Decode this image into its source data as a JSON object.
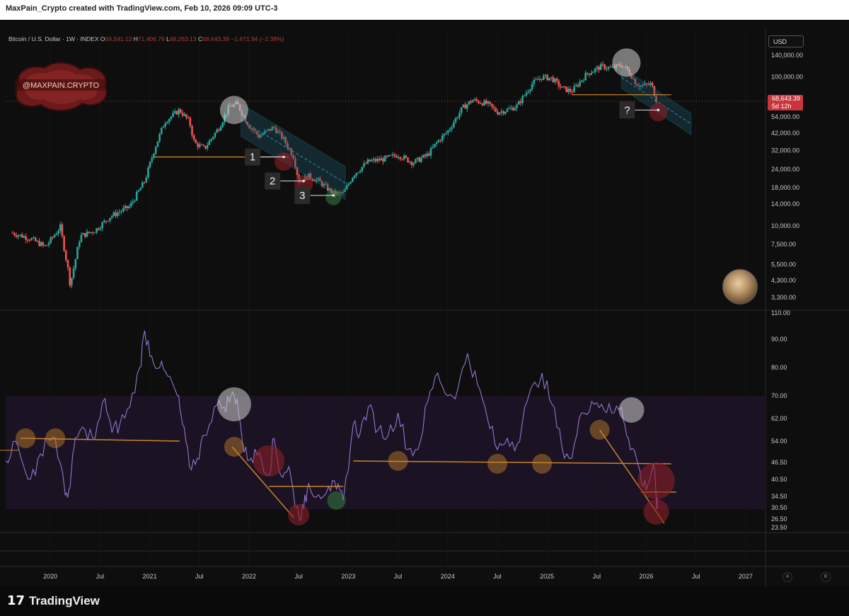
{
  "header": {
    "attribution": "MaxPain_Crypto created with TradingView.com, Feb 10, 2026 09:09 UTC-3"
  },
  "legend": {
    "symbol": "Bitcoin / U.S. Dollar · 1W · INDEX",
    "open_label": "O",
    "open": "69,541.13",
    "high_label": "H",
    "high": "71,406.76",
    "low_label": "L",
    "low": "68,263.13",
    "close_label": "C",
    "close": "68,643.39",
    "change": "−1,671.94 (−2.38%)"
  },
  "currency": "USD",
  "price_tag": {
    "price": "68,643.39",
    "countdown": "5d 12h"
  },
  "watermark": {
    "text": "@MAXPAIN.CRYPTO"
  },
  "footer": {
    "brand": "TradingView",
    "brand_mark": "17"
  },
  "axis_buttons": [
    "A",
    "B"
  ],
  "colors": {
    "up": "#26a69a",
    "down": "#ef5350",
    "rsi": "#9575cd",
    "trend": "#c8832a",
    "channel": "#1e5c6e",
    "grey_marker": "#c8c8c8",
    "red_marker": "#8a1f26",
    "green_marker": "#2a5a2f",
    "price_tag": "#c8353c"
  },
  "chart_data": [
    {
      "type": "candlestick",
      "name": "Bitcoin / U.S. Dollar",
      "scale": "log",
      "price_ticks": [
        "140,000.00",
        "100,000.00",
        "54,000.00",
        "42,000.00",
        "32,000.00",
        "24,000.00",
        "18,000.00",
        "14,000.00",
        "10,000.00",
        "7,500.00",
        "5,500.00",
        "4,300.00",
        "3,300.00"
      ],
      "price_tick_values": [
        140000,
        100000,
        54000,
        42000,
        32000,
        24000,
        18000,
        14000,
        10000,
        7500,
        5500,
        4300,
        3300
      ],
      "x_ticks": [
        "2020",
        "Jul",
        "2021",
        "Jul",
        "2022",
        "Jul",
        "2023",
        "Jul",
        "2024",
        "Jul",
        "2025",
        "Jul",
        "2026",
        "Jul",
        "2027"
      ],
      "x_tick_dates": [
        2020.0,
        2020.5,
        2021.0,
        2021.5,
        2022.0,
        2022.5,
        2023.0,
        2023.5,
        2024.0,
        2024.5,
        2025.0,
        2025.5,
        2026.0,
        2026.5,
        2027.0
      ],
      "price_path": [
        [
          2019.6,
          9000
        ],
        [
          2019.8,
          8200
        ],
        [
          2019.95,
          7200
        ],
        [
          2020.1,
          9800
        ],
        [
          2020.18,
          5000
        ],
        [
          2020.2,
          4000
        ],
        [
          2020.3,
          8500
        ],
        [
          2020.45,
          9300
        ],
        [
          2020.6,
          11500
        ],
        [
          2020.8,
          13500
        ],
        [
          2020.95,
          20000
        ],
        [
          2021.05,
          33000
        ],
        [
          2021.15,
          50000
        ],
        [
          2021.3,
          60000
        ],
        [
          2021.4,
          50000
        ],
        [
          2021.45,
          36000
        ],
        [
          2021.55,
          33000
        ],
        [
          2021.7,
          46000
        ],
        [
          2021.8,
          63000
        ],
        [
          2021.88,
          66000
        ],
        [
          2022.0,
          47000
        ],
        [
          2022.1,
          40000
        ],
        [
          2022.25,
          46000
        ],
        [
          2022.35,
          38000
        ],
        [
          2022.45,
          29000
        ],
        [
          2022.5,
          20000
        ],
        [
          2022.6,
          21500
        ],
        [
          2022.7,
          20000
        ],
        [
          2022.85,
          16500
        ],
        [
          2022.95,
          16500
        ],
        [
          2023.05,
          22000
        ],
        [
          2023.2,
          27000
        ],
        [
          2023.35,
          28000
        ],
        [
          2023.5,
          30000
        ],
        [
          2023.65,
          26500
        ],
        [
          2023.8,
          30000
        ],
        [
          2023.9,
          37000
        ],
        [
          2024.0,
          43000
        ],
        [
          2024.15,
          62000
        ],
        [
          2024.25,
          70000
        ],
        [
          2024.4,
          66000
        ],
        [
          2024.5,
          58000
        ],
        [
          2024.6,
          60000
        ],
        [
          2024.7,
          64000
        ],
        [
          2024.85,
          90000
        ],
        [
          2024.95,
          100000
        ],
        [
          2025.05,
          98000
        ],
        [
          2025.15,
          84000
        ],
        [
          2025.25,
          80000
        ],
        [
          2025.4,
          105000
        ],
        [
          2025.55,
          118000
        ],
        [
          2025.65,
          114000
        ],
        [
          2025.75,
          121000
        ],
        [
          2025.82,
          110000
        ],
        [
          2025.9,
          90000
        ],
        [
          2025.96,
          87000
        ],
        [
          2026.05,
          90000
        ],
        [
          2026.1,
          70000
        ],
        [
          2026.11,
          68643
        ]
      ],
      "support_lines": [
        [
          [
            2021.05,
            29000
          ],
          [
            2022.4,
            29000
          ]
        ],
        [
          [
            2025.25,
            76000
          ],
          [
            2026.25,
            76000
          ]
        ]
      ],
      "channels": [
        {
          "upper": [
            [
              2021.92,
              66000
            ],
            [
              2022.97,
              25000
            ]
          ],
          "lower": [
            [
              2021.92,
              40000
            ],
            [
              2022.97,
              15000
            ]
          ]
        },
        {
          "upper": [
            [
              2025.75,
              117000
            ],
            [
              2026.45,
              57000
            ]
          ],
          "lower": [
            [
              2025.75,
              84000
            ],
            [
              2026.45,
              41000
            ]
          ]
        }
      ],
      "markers": [
        {
          "label": "1",
          "target": [
            2022.35,
            29000
          ]
        },
        {
          "label": "2",
          "target": [
            2022.55,
            20000
          ]
        },
        {
          "label": "3",
          "target": [
            2022.85,
            16000
          ]
        },
        {
          "label": "?",
          "target": [
            2026.12,
            60000
          ]
        }
      ],
      "highlights": [
        {
          "color": "grey",
          "at": [
            2021.85,
            60000
          ]
        },
        {
          "color": "red",
          "at": [
            2022.35,
            27000
          ]
        },
        {
          "color": "red",
          "at": [
            2022.55,
            19000
          ]
        },
        {
          "color": "green",
          "at": [
            2022.85,
            15500
          ]
        },
        {
          "color": "grey",
          "at": [
            2025.8,
            125000
          ]
        },
        {
          "color": "red",
          "at": [
            2026.12,
            58000
          ]
        }
      ]
    },
    {
      "type": "line",
      "name": "RSI",
      "y_ticks": [
        "110.00",
        "90.00",
        "80.00",
        "70.00",
        "62.00",
        "54.00",
        "46.50",
        "40.50",
        "34.50",
        "30.50",
        "26.50",
        "23.50"
      ],
      "y_tick_values": [
        110,
        90,
        80,
        70,
        62,
        54,
        46.5,
        40.5,
        34.5,
        30.5,
        26.5,
        23.5
      ],
      "band": [
        30,
        70
      ],
      "rsi_path": [
        [
          2019.55,
          47
        ],
        [
          2019.65,
          54
        ],
        [
          2019.75,
          43
        ],
        [
          2019.85,
          42
        ],
        [
          2019.95,
          55
        ],
        [
          2020.05,
          55
        ],
        [
          2020.15,
          35
        ],
        [
          2020.2,
          38
        ],
        [
          2020.25,
          55
        ],
        [
          2020.35,
          58
        ],
        [
          2020.45,
          55
        ],
        [
          2020.55,
          69
        ],
        [
          2020.62,
          57
        ],
        [
          2020.7,
          60
        ],
        [
          2020.8,
          66
        ],
        [
          2020.9,
          80
        ],
        [
          2020.95,
          93
        ],
        [
          2021.02,
          84
        ],
        [
          2021.1,
          80
        ],
        [
          2021.18,
          77
        ],
        [
          2021.28,
          70
        ],
        [
          2021.33,
          60
        ],
        [
          2021.4,
          45
        ],
        [
          2021.48,
          48
        ],
        [
          2021.55,
          56
        ],
        [
          2021.65,
          66
        ],
        [
          2021.75,
          66
        ],
        [
          2021.82,
          70
        ],
        [
          2021.88,
          69
        ],
        [
          2021.95,
          50
        ],
        [
          2022.02,
          48
        ],
        [
          2022.1,
          50
        ],
        [
          2022.2,
          42
        ],
        [
          2022.25,
          55
        ],
        [
          2022.32,
          42
        ],
        [
          2022.4,
          45
        ],
        [
          2022.45,
          35
        ],
        [
          2022.5,
          28
        ],
        [
          2022.55,
          30
        ],
        [
          2022.6,
          39
        ],
        [
          2022.7,
          35
        ],
        [
          2022.8,
          38
        ],
        [
          2022.88,
          37
        ],
        [
          2022.95,
          33
        ],
        [
          2023.05,
          60
        ],
        [
          2023.12,
          57
        ],
        [
          2023.2,
          66
        ],
        [
          2023.3,
          58
        ],
        [
          2023.4,
          56
        ],
        [
          2023.5,
          64
        ],
        [
          2023.6,
          51
        ],
        [
          2023.7,
          51
        ],
        [
          2023.8,
          68
        ],
        [
          2023.9,
          78
        ],
        [
          2024.0,
          70
        ],
        [
          2024.1,
          72
        ],
        [
          2024.2,
          85
        ],
        [
          2024.3,
          74
        ],
        [
          2024.4,
          62
        ],
        [
          2024.5,
          51
        ],
        [
          2024.6,
          55
        ],
        [
          2024.7,
          53
        ],
        [
          2024.8,
          68
        ],
        [
          2024.95,
          78
        ],
        [
          2025.05,
          67
        ],
        [
          2025.15,
          52
        ],
        [
          2025.25,
          48
        ],
        [
          2025.35,
          64
        ],
        [
          2025.45,
          68
        ],
        [
          2025.55,
          67
        ],
        [
          2025.65,
          64
        ],
        [
          2025.75,
          66
        ],
        [
          2025.82,
          55
        ],
        [
          2025.9,
          48
        ],
        [
          2025.97,
          38
        ],
        [
          2026.03,
          40
        ],
        [
          2026.07,
          46
        ],
        [
          2026.1,
          34
        ],
        [
          2026.11,
          30
        ]
      ],
      "trend_lines": [
        [
          [
            2019.7,
            55
          ],
          [
            2021.3,
            54
          ]
        ],
        [
          [
            2021.83,
            52
          ],
          [
            2022.45,
            27
          ]
        ],
        [
          [
            2022.2,
            38
          ],
          [
            2022.95,
            38
          ]
        ],
        [
          [
            2023.05,
            47
          ],
          [
            2026.25,
            46
          ]
        ],
        [
          [
            2025.53,
            58
          ],
          [
            2026.18,
            25
          ]
        ],
        [
          [
            2025.95,
            36
          ],
          [
            2026.3,
            36
          ]
        ]
      ],
      "highlights": [
        {
          "color": "orange",
          "at": [
            2019.75,
            55
          ]
        },
        {
          "color": "orange",
          "at": [
            2020.05,
            55
          ]
        },
        {
          "color": "grey",
          "at": [
            2021.85,
            67
          ]
        },
        {
          "color": "orange",
          "at": [
            2021.85,
            52
          ]
        },
        {
          "color": "red",
          "at": [
            2022.2,
            47
          ]
        },
        {
          "color": "red",
          "at": [
            2022.5,
            28
          ]
        },
        {
          "color": "green",
          "at": [
            2022.88,
            33
          ]
        },
        {
          "color": "orange",
          "at": [
            2023.5,
            47
          ]
        },
        {
          "color": "orange",
          "at": [
            2024.5,
            46
          ]
        },
        {
          "color": "orange",
          "at": [
            2024.95,
            46
          ]
        },
        {
          "color": "orange",
          "at": [
            2025.53,
            58
          ]
        },
        {
          "color": "grey",
          "at": [
            2025.85,
            65
          ]
        },
        {
          "color": "red",
          "at": [
            2026.1,
            40
          ]
        },
        {
          "color": "red",
          "at": [
            2026.1,
            29
          ]
        }
      ]
    }
  ]
}
